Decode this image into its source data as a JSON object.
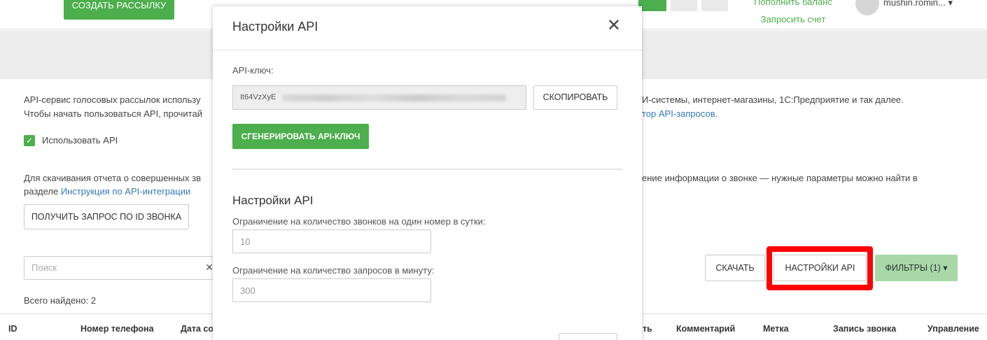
{
  "topbar": {
    "create_button": "СОЗДАТЬ РАССЫЛКУ",
    "top_up_balance": "Пополнить баланс",
    "request_invoice": "Запросить счет",
    "user_name": "mushin.romin... ▾"
  },
  "intro": {
    "line1_left": "API-сервис голосовых рассылок использу",
    "line1_right": "И-системы, интернет-магазины, 1С:Предприятие и так далее.",
    "line2_left": "Чтобы начать пользоваться API, прочитай",
    "line2_right_link": "тор API-запросов",
    "line2_right_end": "."
  },
  "use_api": {
    "checked_glyph": "✓",
    "label": "Использовать API"
  },
  "report": {
    "line1_left": "Для скачивания отчета о совершенных зв",
    "line1_right": "ение информации о звонке — нужные параметры можно найти в",
    "line2_prefix": "разделе ",
    "line2_link": "Инструкция по API-интеграции",
    "get_request_button": "ПОЛУЧИТЬ ЗАПРОС ПО ID ЗВОНКА"
  },
  "search": {
    "placeholder": "Поиск",
    "clear_glyph": "✕"
  },
  "actions": {
    "download": "СКАЧАТЬ",
    "api_settings": "НАСТРОЙКИ API",
    "filters": "ФИЛЬТРЫ (1) ▾"
  },
  "found": "Всего найдено: 2",
  "table": {
    "columns": [
      "ID",
      "Номер телефона",
      "Дата со",
      "ть",
      "Комментарий",
      "Метка",
      "Запись звонка",
      "Управление"
    ]
  },
  "modal": {
    "title": "Настройки API",
    "close_glyph": "✕",
    "api_key_label": "API-ключ:",
    "api_key_value": "It64VzXyE",
    "copy_button": "СКОПИРОВАТЬ",
    "generate_button": "СГЕНЕРИРОВАТЬ API-КЛЮЧ",
    "section_title": "Настройки API",
    "calls_limit_label": "Ограничение на количество звонков на один номер в сутки:",
    "calls_limit_value": "10",
    "requests_limit_label": "Ограничение на количество запросов в минуту:",
    "requests_limit_value": "300"
  },
  "colors": {
    "accent_green": "#4cae4c",
    "highlight_red": "#ff0000",
    "link_blue": "#337ab7"
  }
}
